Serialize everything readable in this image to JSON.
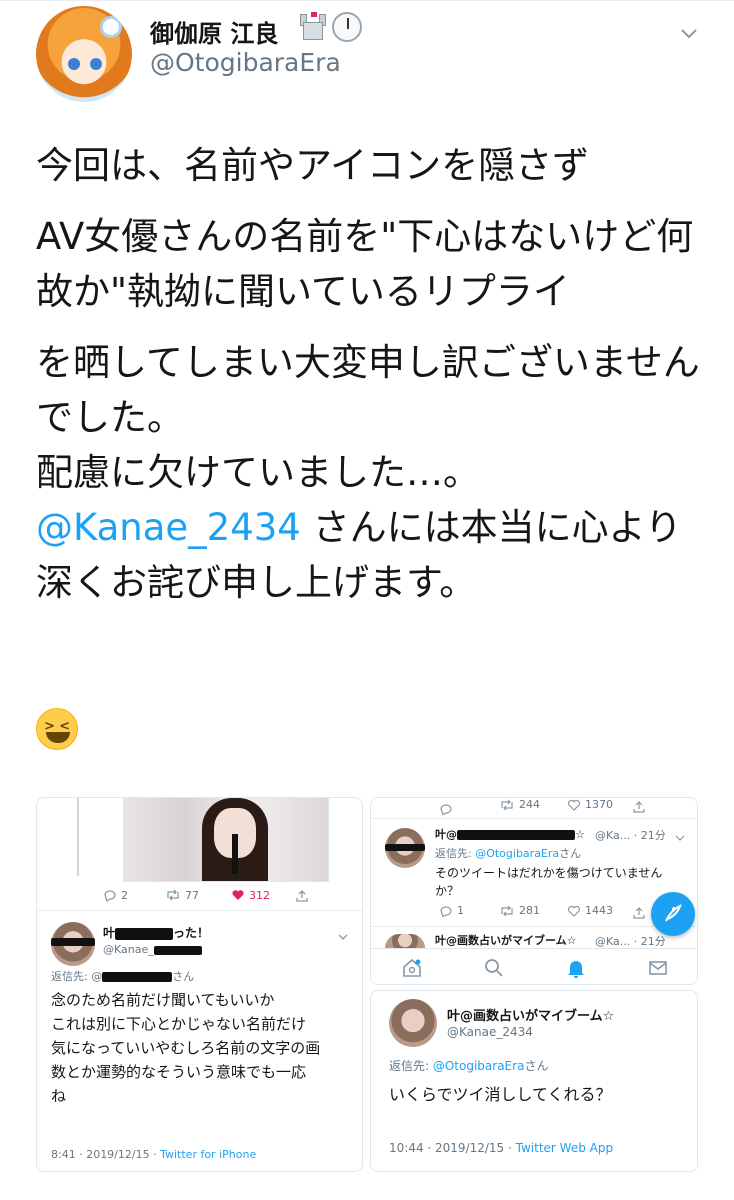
{
  "author": {
    "display_name": "御伽原 江良",
    "username": "@OtogibaraEra",
    "badges": [
      "castle-emoji",
      "clock-emoji"
    ]
  },
  "tweet": {
    "paragraph_1": "今回は、名前やアイコンを隠さず",
    "paragraph_2": "AV女優さんの名前を\"下心はないけど何故か\"執拗に聞いているリプライ",
    "paragraph_3a": "を晒してしまい大変申し訳ございませんでした。",
    "paragraph_3b": "配慮に欠けていました…。",
    "mention": "@Kanae_2434",
    "paragraph_3c": " さんには本当に心より深くお詫び申し上げます。",
    "emoji": "laughing-squinting-face"
  },
  "embedded_left": {
    "top_actions": {
      "replies": "2",
      "retweets": "77",
      "likes": "312"
    },
    "reply": {
      "name_start": "叶",
      "name_end": "った！",
      "handle": "@Kanae_",
      "reply_to_prefix": "返信先: @",
      "reply_to_suffix": "さん",
      "lines": [
        "念のため名前だけ聞いてもいいか",
        "これは別に下心とかじゃない名前だけ",
        "気になっていいやむしろ名前の文字の画",
        "数とか運勢的なそういう意味でも一応",
        "ね"
      ],
      "timestamp": "8:41 · 2019/12/15 · ",
      "source": "Twitter for iPhone"
    }
  },
  "embedded_right_top": {
    "top_actions": {
      "retweets": "244",
      "likes": "1370"
    },
    "reply": {
      "name_start": "叶@",
      "name_end": "☆",
      "handle_time": "@Ka... · 21分",
      "reply_to_prefix": "返信先: ",
      "reply_to_mention": "@OtogibaraEra",
      "reply_to_suffix": "さん",
      "lines": [
        "そのツイートはだれかを傷つけていません",
        "か？"
      ],
      "actions": {
        "replies": "1",
        "retweets": "281",
        "likes": "1443"
      }
    },
    "next_preview": {
      "name": "叶@画数占いがマイブーム☆",
      "handle_time": "@Ka... · 21分"
    }
  },
  "embedded_right_bottom": {
    "name": "叶@画数占いがマイブーム☆",
    "handle": "@Kanae_2434",
    "reply_to_prefix": "返信先: ",
    "reply_to_mention": "@OtogibaraEra",
    "reply_to_suffix": "さん",
    "text": "いくらでツイ消ししてくれる？",
    "timestamp": "10:44 · 2019/12/15 · ",
    "source": "Twitter Web App"
  },
  "colors": {
    "accent": "#1da1f2",
    "like_red": "#e0245e",
    "secondary": "#657786"
  }
}
